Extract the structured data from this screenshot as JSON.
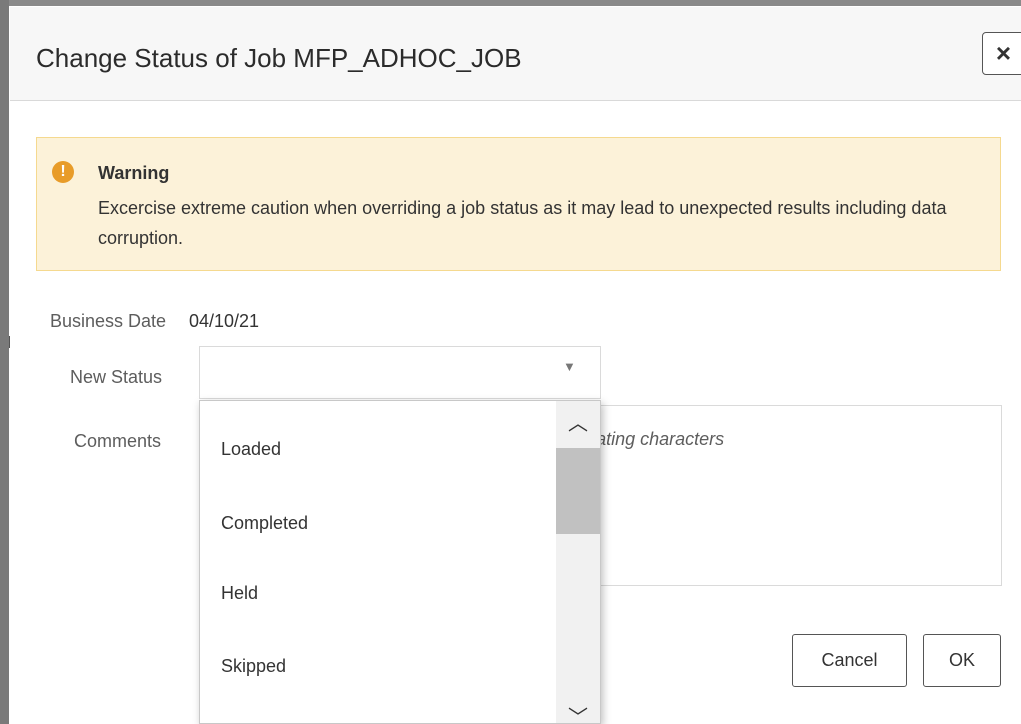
{
  "dialog": {
    "title": "Change Status of Job MFP_ADHOC_JOB",
    "close_label": "×"
  },
  "warning": {
    "icon_symbol": "!",
    "title": "Warning",
    "text": "Excercise extreme caution when overriding a job status as it may lead to unexpected results including data corruption."
  },
  "form": {
    "business_date_label": "Business Date",
    "business_date_value": "04/10/21",
    "new_status_label": "New Status",
    "new_status_value": "",
    "comments_label": "Comments",
    "comments_placeholder_visible": "t least fifteen non-repeating characters"
  },
  "dropdown": {
    "options": [
      "Loaded",
      "Completed",
      "Held",
      "Skipped"
    ]
  },
  "buttons": {
    "cancel": "Cancel",
    "ok": "OK"
  },
  "icons": {
    "close": "close-icon",
    "warning": "warning-icon",
    "caret": "chevron-down-icon",
    "scroll_up": "chevron-up-icon",
    "scroll_down": "chevron-down-icon"
  },
  "colors": {
    "warning_bg": "#fcf2d9",
    "warning_border": "#f5d98f",
    "warning_icon": "#e89c29",
    "header_bg": "#f7f7f7"
  }
}
